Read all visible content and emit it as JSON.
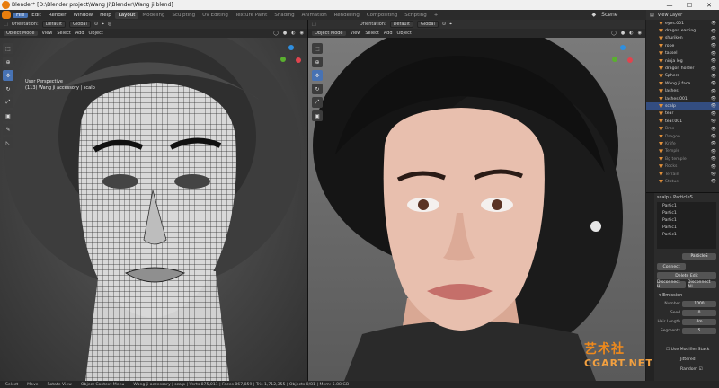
{
  "window": {
    "title": "Blender* [D:\\Blender project\\Wang Ji\\Blender\\Wang ji.blend]",
    "controls": [
      "—",
      "☐",
      "✕"
    ]
  },
  "menu": [
    "File",
    "Edit",
    "Render",
    "Window",
    "Help"
  ],
  "workspaces": [
    "Layout",
    "Modeling",
    "Sculpting",
    "UV Editing",
    "Texture Paint",
    "Shading",
    "Animation",
    "Rendering",
    "Compositing",
    "Scripting",
    "+"
  ],
  "active_workspace": "Layout",
  "scene_label": "Scene",
  "view_layer_label": "View Layer",
  "left_header": {
    "orientation_label": "Orientation:",
    "orientation_value": "Default",
    "transform_orientation": "Global",
    "mode": "Object Mode",
    "menus": [
      "View",
      "Select",
      "Add",
      "Object"
    ]
  },
  "right_header": {
    "orientation_label": "Orientation:",
    "orientation_value": "Default",
    "transform_orientation": "Global",
    "mode": "Object Mode",
    "menus": [
      "View",
      "Select",
      "Add",
      "Object"
    ]
  },
  "left_viewport": {
    "perspective": "User Perspective",
    "object_line": "(113) Wang ji accessory | scalp"
  },
  "outliner": {
    "rows": [
      {
        "name": "eyes.001",
        "sel": false,
        "dim": false
      },
      {
        "name": "dragon earring",
        "sel": false,
        "dim": false
      },
      {
        "name": "shuriken",
        "sel": false,
        "dim": false
      },
      {
        "name": "rope",
        "sel": false,
        "dim": false
      },
      {
        "name": "tassel",
        "sel": false,
        "dim": false
      },
      {
        "name": "ninja leg",
        "sel": false,
        "dim": false
      },
      {
        "name": "dragon holder",
        "sel": false,
        "dim": false
      },
      {
        "name": "Sphere",
        "sel": false,
        "dim": false
      },
      {
        "name": "Wang ji face",
        "sel": false,
        "dim": false
      },
      {
        "name": "lashes",
        "sel": false,
        "dim": false
      },
      {
        "name": "lashes.001",
        "sel": false,
        "dim": false
      },
      {
        "name": "scalp",
        "sel": true,
        "dim": false
      },
      {
        "name": "tear",
        "sel": false,
        "dim": false
      },
      {
        "name": "tear.001",
        "sel": false,
        "dim": false
      },
      {
        "name": "Bros",
        "sel": false,
        "dim": true
      },
      {
        "name": "Dragon",
        "sel": false,
        "dim": true
      },
      {
        "name": "Knife",
        "sel": false,
        "dim": true
      },
      {
        "name": "Temple",
        "sel": false,
        "dim": true
      },
      {
        "name": "Bg temple",
        "sel": false,
        "dim": true
      },
      {
        "name": "Rocks",
        "sel": false,
        "dim": true
      },
      {
        "name": "Terrain",
        "sel": false,
        "dim": true
      },
      {
        "name": "Statue",
        "sel": false,
        "dim": true
      }
    ]
  },
  "properties": {
    "object": "scalp",
    "panel": "ParticleS",
    "particles": [
      "Partic1",
      "Partic1",
      "Partic1",
      "Partic1",
      "Partic1"
    ],
    "particle_sub": "ParticleS",
    "buttons": {
      "connect": "Connect",
      "delete_edit": "Delete Edit",
      "disconnect": "Disconnect H...",
      "disconnect_all": "Disconnect All"
    },
    "emission_header": "Emission",
    "fields": [
      {
        "label": "Number",
        "value": "1000"
      },
      {
        "label": "Seed",
        "value": "0"
      },
      {
        "label": "Hair Length",
        "value": "4m"
      },
      {
        "label": "Segments",
        "value": "5"
      }
    ],
    "modifier_stack": "Use Modifier Stack",
    "jittered": "Jittered",
    "random": "Random"
  },
  "statusbar": {
    "items": [
      "Select",
      "Move",
      "Rotate View",
      "Object Context Menu",
      "Wang ji accessory | scalp | Verts 875,011 | Faces 867,859 | Tris 1,712,355 | Objects 0/81 | Mem: 5.88 GB"
    ]
  },
  "watermark": {
    "line1": "艺术社",
    "line2": "CGART.NET"
  },
  "colors": {
    "accent": "#4772b3",
    "blender_orange": "#e87d0d",
    "selected_row": "#334d80"
  }
}
